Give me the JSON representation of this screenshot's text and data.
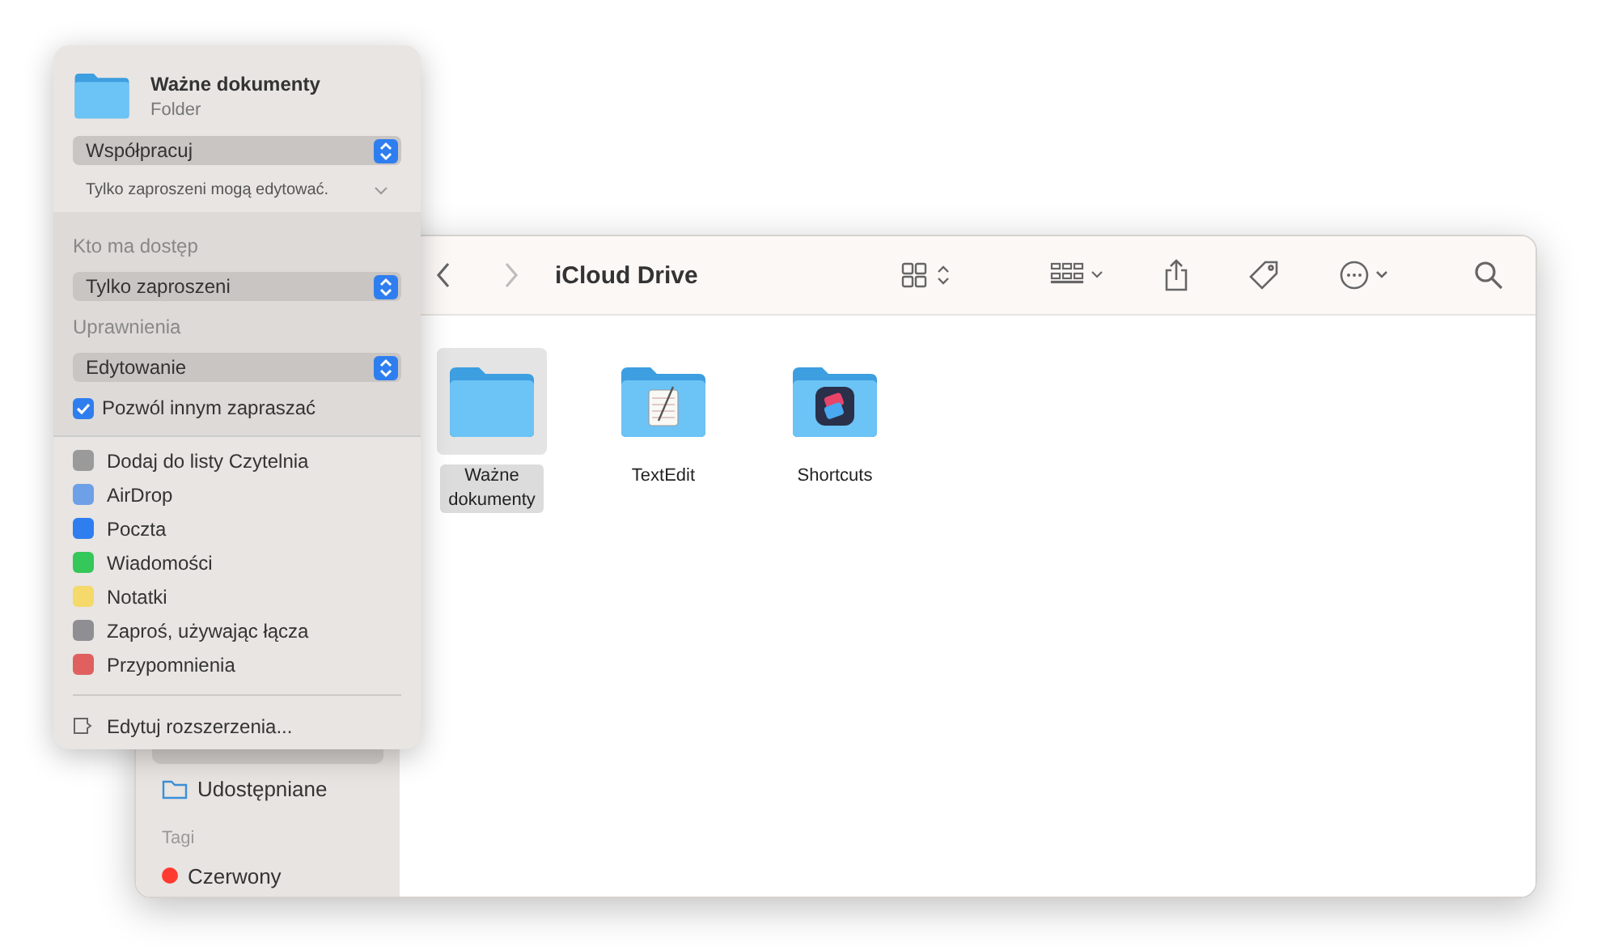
{
  "popover": {
    "title": "Ważne dokumenty",
    "subtitle": "Folder",
    "collaborate_select": "Współpracuj",
    "summary": "Tylko zaproszeni mogą edytować.",
    "access_label": "Kto ma dostęp",
    "access_select": "Tylko zaproszeni",
    "permissions_label": "Uprawnienia",
    "permissions_select": "Edytowanie",
    "allow_invite": {
      "label": "Pozwól innym zapraszać",
      "checked": true
    },
    "share_items": [
      {
        "label": "Dodaj do listy Czytelnia",
        "color": "#9a9a9a"
      },
      {
        "label": "AirDrop",
        "color": "#6ea0e8"
      },
      {
        "label": "Poczta",
        "color": "#2f7ef0"
      },
      {
        "label": "Wiadomości",
        "color": "#34c759"
      },
      {
        "label": "Notatki",
        "color": "#f5d96a"
      },
      {
        "label": "Zaproś, używając łącza",
        "color": "#8e8e93"
      },
      {
        "label": "Przypomnienia",
        "color": "#e06060"
      }
    ],
    "edit_extensions": "Edytuj rozszerzenia..."
  },
  "window": {
    "title": "iCloud Drive",
    "back_disabled": false,
    "forward_disabled": true
  },
  "sidebar": {
    "items": [
      {
        "selected": true
      },
      {
        "label": "Udostępniane",
        "selected": false
      }
    ],
    "tags_heading": "Tagi",
    "tags": [
      {
        "label": "Czerwony",
        "color": "#ff3b30"
      }
    ]
  },
  "files": [
    {
      "name": "Ważne dokumenty",
      "kind": "folder",
      "selected": true
    },
    {
      "name": "TextEdit",
      "kind": "textedit",
      "selected": false
    },
    {
      "name": "Shortcuts",
      "kind": "shortcuts",
      "selected": false
    }
  ]
}
